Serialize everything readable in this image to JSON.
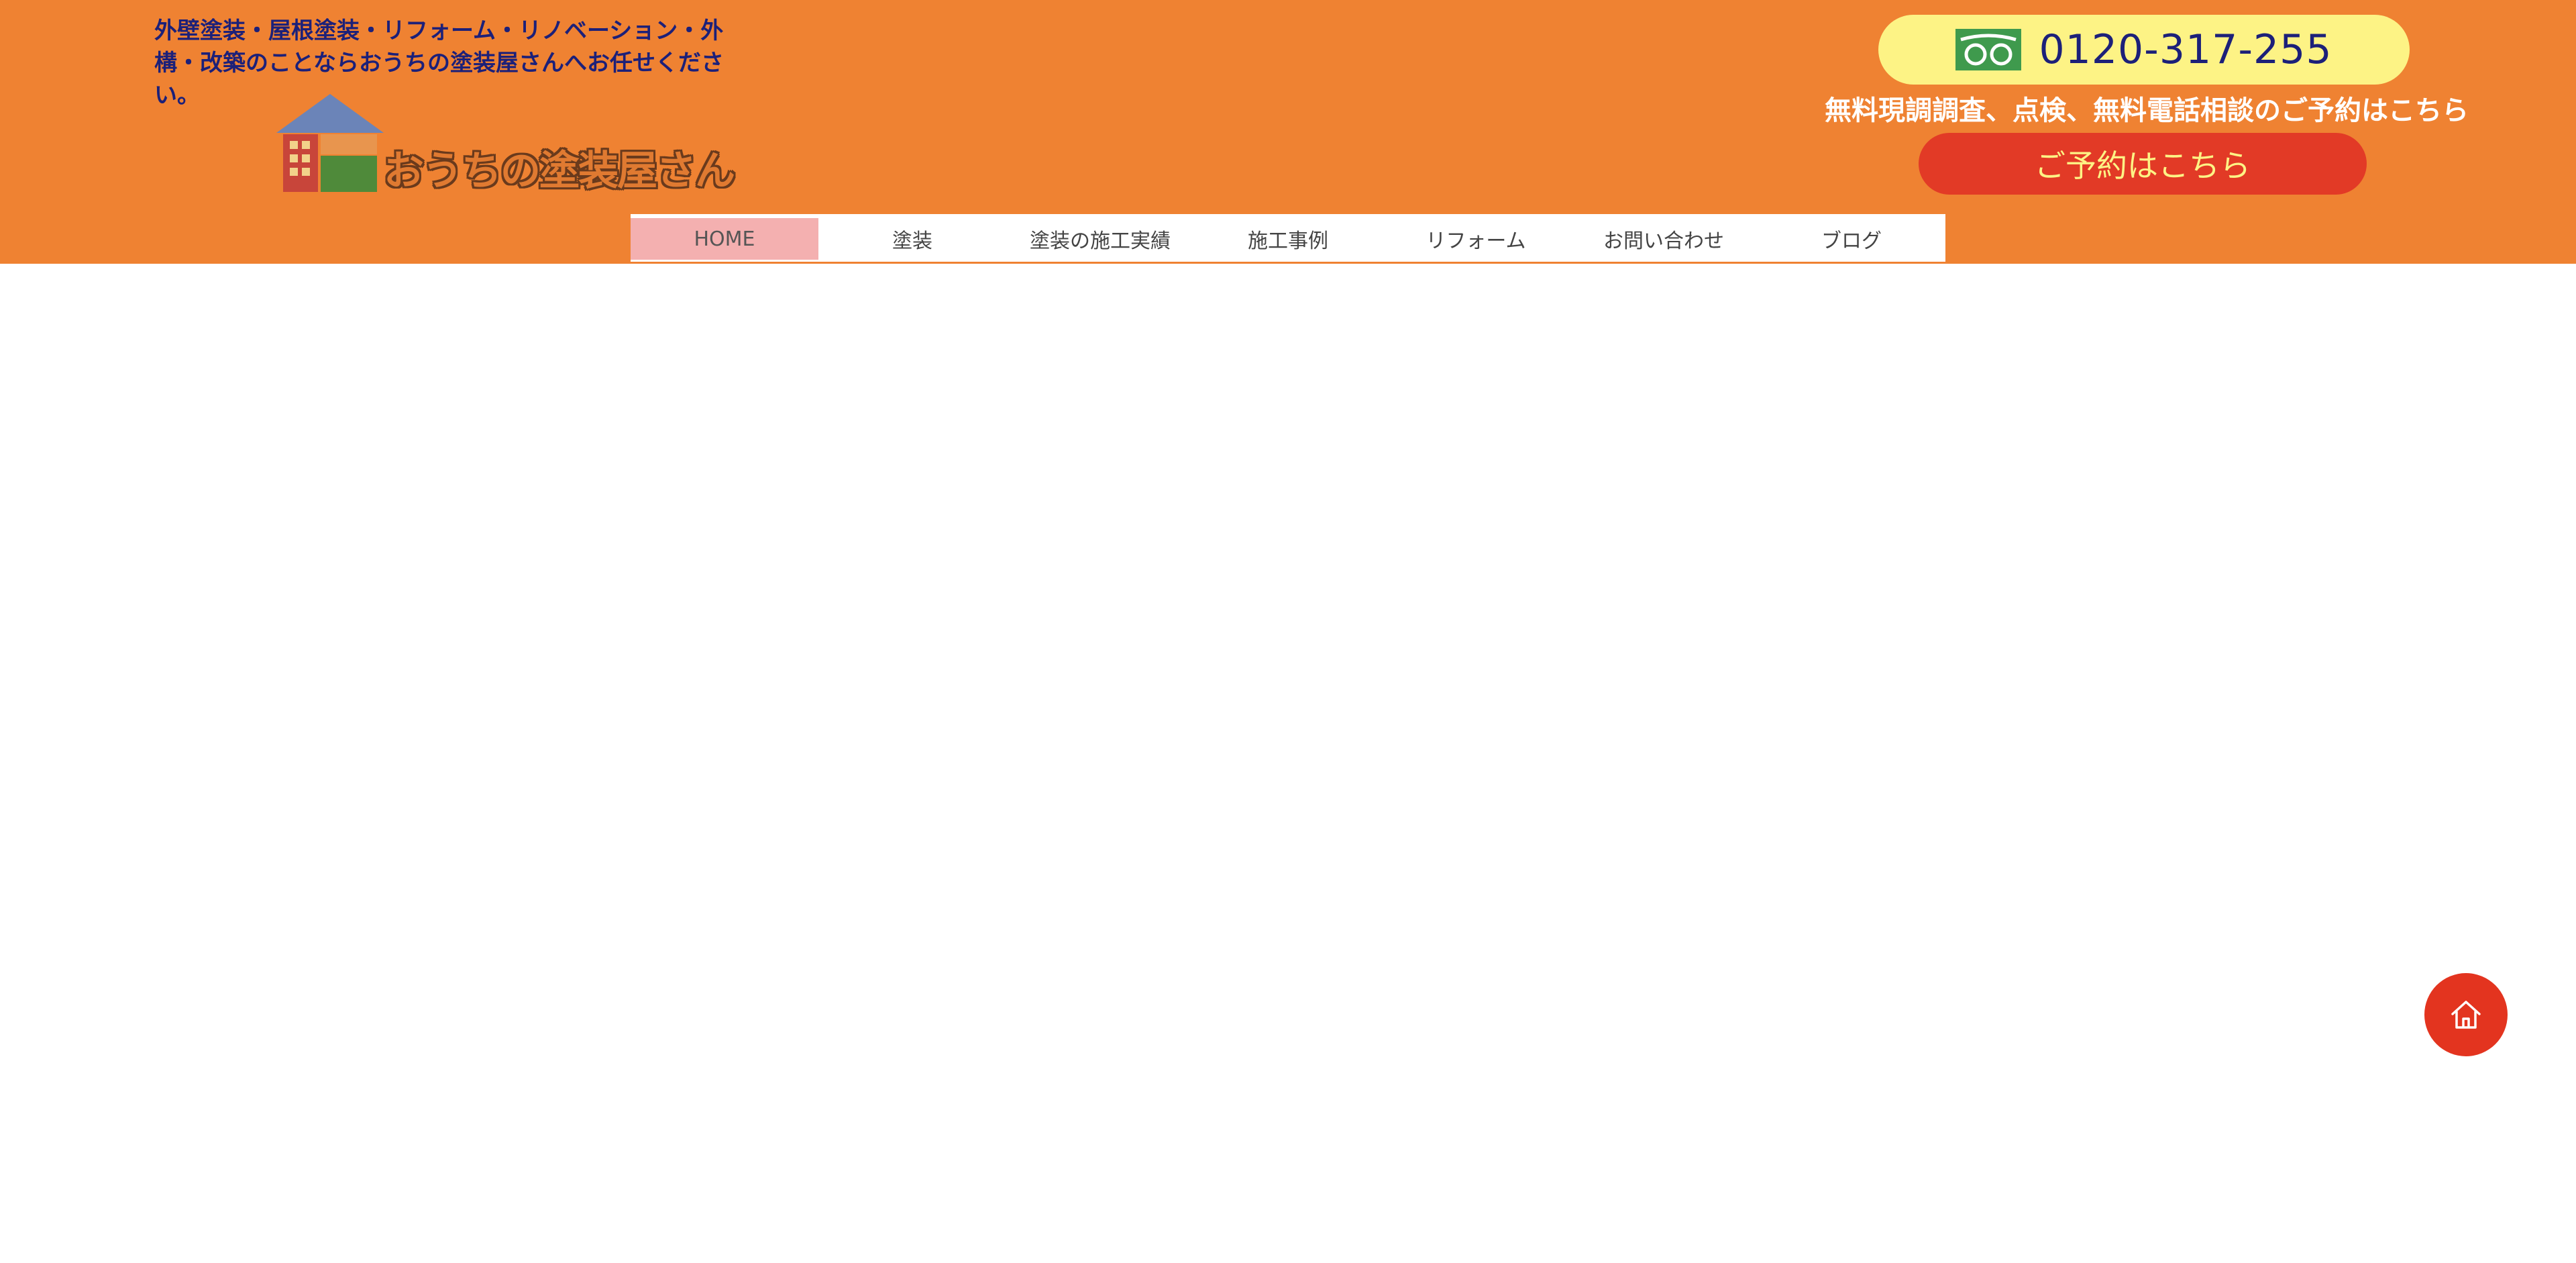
{
  "header": {
    "tagline": "外壁塗装・屋根塗装・リフォーム・リノベーション・外構・改築のことならおうちの塗装屋さんへお任せください。",
    "logo": {
      "text": "おうちの塗装屋さん",
      "icon": "house-logo-icon"
    },
    "phone": {
      "number": "0120-317-255",
      "icon": "free-dial-icon"
    },
    "reserve_caption": "無料現調調査、点検、無料電話相談のご予約はこちら",
    "reserve_button": "ご予約はこちら"
  },
  "nav": {
    "items": [
      {
        "label": "HOME",
        "active": true
      },
      {
        "label": "塗装"
      },
      {
        "label": "塗装の施工実績"
      },
      {
        "label": "施工事例"
      },
      {
        "label": "リフォーム"
      },
      {
        "label": "お問い合わせ"
      },
      {
        "label": "ブログ"
      }
    ]
  },
  "fab": {
    "icon": "home-icon"
  },
  "colors": {
    "header_bg": "#ef8232",
    "tagline_text": "#1c2079",
    "phone_pill": "#fdf385",
    "reserve_button": "#e23a26",
    "nav_active": "#f4b0b0",
    "fab": "#e3341f"
  }
}
